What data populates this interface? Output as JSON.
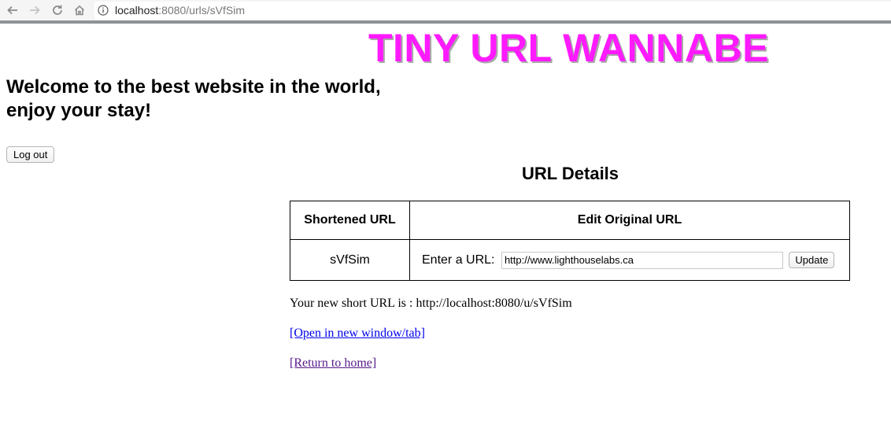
{
  "browser": {
    "url_host": "localhost",
    "url_rest": ":8080/urls/sVfSim"
  },
  "page": {
    "site_title": "TINY URL WANNABE",
    "welcome_line1": "Welcome to the best website in the world,",
    "welcome_line2": "enjoy your stay!",
    "logout_label": "Log out",
    "details_title": "URL Details"
  },
  "table": {
    "headers": [
      "Shortened URL",
      "Edit Original URL"
    ],
    "short_url": "sVfSim",
    "enter_label": "Enter a URL:",
    "input_value": "http://www.lighthouselabs.ca",
    "update_label": "Update"
  },
  "footer": {
    "new_url_text": "Your new short URL is : http://localhost:8080/u/sVfSim",
    "open_link": "[Open in new window/tab]",
    "home_link": "[Return to home]"
  },
  "colors": {
    "title": "#ff1aff",
    "link": "#0000ee",
    "visited_link": "#551a8b"
  }
}
